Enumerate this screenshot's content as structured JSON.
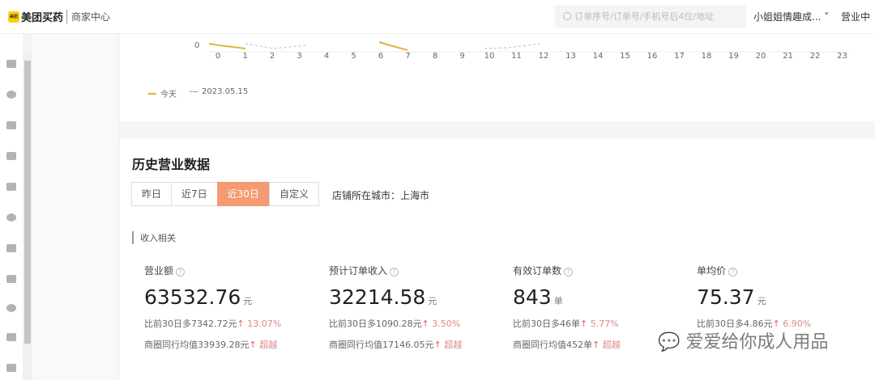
{
  "header": {
    "logo_mark": "美团",
    "brand": "美团买药",
    "subtitle": "商家中心",
    "search_placeholder": "订单序号/订单号/手机号后4位/地址",
    "shop_name": "小姐姐情趣成...",
    "shop_status": "营业中"
  },
  "chart_data": {
    "type": "line",
    "x": [
      "0",
      "1",
      "2",
      "3",
      "4",
      "5",
      "6",
      "7",
      "8",
      "9",
      "10",
      "11",
      "12",
      "13",
      "14",
      "15",
      "16",
      "17",
      "18",
      "19",
      "20",
      "21",
      "22",
      "23"
    ],
    "y_ticks": [
      "0"
    ],
    "legend": [
      {
        "name": "今天",
        "color": "#e0b53a",
        "style": "solid"
      },
      {
        "name": "2023.05.15",
        "color": "#aab",
        "style": "dashed"
      }
    ]
  },
  "history": {
    "title": "历史营业数据",
    "tabs": [
      {
        "label": "昨日"
      },
      {
        "label": "近7日"
      },
      {
        "label": "近30日",
        "active": true
      },
      {
        "label": "自定义"
      }
    ],
    "city_label": "店铺所在城市：上海市",
    "section_label": "收入相关",
    "metrics": [
      {
        "label": "营业额",
        "value": "63532.76",
        "unit": "元",
        "compare": "比前30日多7342.72元",
        "compare_pct": "13.07%",
        "peer": "商圈同行均值33939.28元",
        "peer_result": "超越"
      },
      {
        "label": "预计订单收入",
        "value": "32214.58",
        "unit": "元",
        "compare": "比前30日多1090.28元",
        "compare_pct": "3.50%",
        "peer": "商圈同行均值17146.05元",
        "peer_result": "超越"
      },
      {
        "label": "有效订单数",
        "value": "843",
        "unit": "单",
        "compare": "比前30日多46单",
        "compare_pct": "5.77%",
        "peer": "商圈同行均值452单",
        "peer_result": "超越"
      },
      {
        "label": "单均价",
        "value": "75.37",
        "unit": "元",
        "compare": "比前30日多4.86元",
        "compare_pct": "6.90%",
        "peer": "",
        "peer_result": ""
      }
    ]
  },
  "watermark": "爱爱给你成人用品"
}
